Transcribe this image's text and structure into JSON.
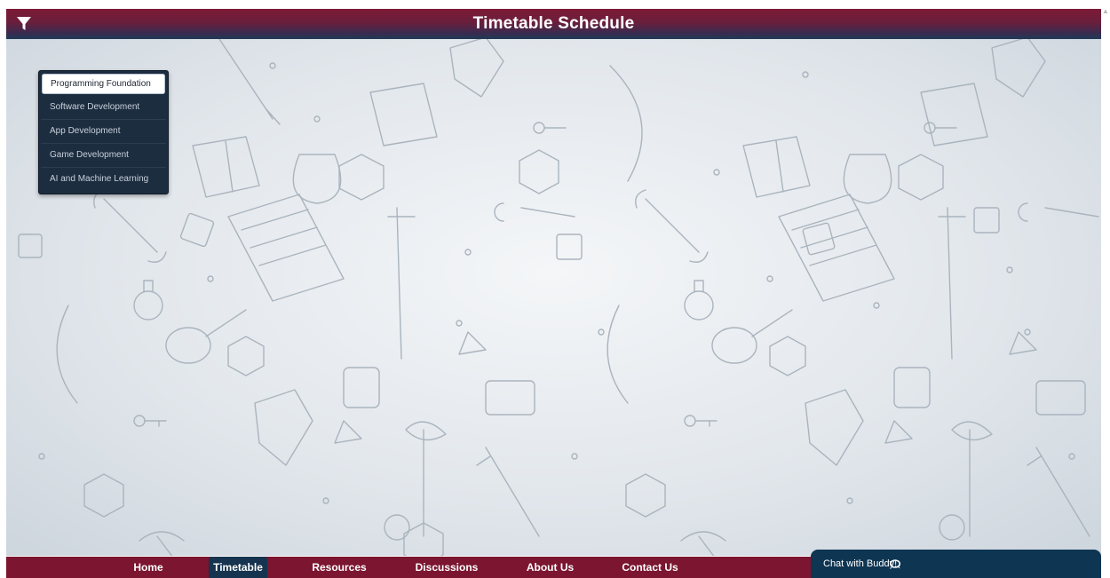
{
  "header": {
    "title": "Timetable Schedule",
    "filter_icon": "filter-funnel-icon",
    "gradient": [
      "#7c1a36",
      "#1f3a55"
    ]
  },
  "dropdown": {
    "items": [
      {
        "label": "Programming Foundation",
        "selected": true
      },
      {
        "label": "Software Development",
        "selected": false
      },
      {
        "label": "App Development",
        "selected": false
      },
      {
        "label": "Game Development",
        "selected": false
      },
      {
        "label": "AI and Machine Learning",
        "selected": false
      }
    ],
    "background": "#1d2d40"
  },
  "footer": {
    "background": "#7b1530",
    "nav": [
      {
        "label": "Home",
        "active": false
      },
      {
        "label": "Timetable",
        "active": true
      },
      {
        "label": "Resources",
        "active": false
      },
      {
        "label": "Discussions",
        "active": false
      },
      {
        "label": "About Us",
        "active": false
      },
      {
        "label": "Contact Us",
        "active": false
      }
    ],
    "active_color": "#16344f"
  },
  "chat": {
    "label": "Chat with Buddy!",
    "icon": "chat-bubble-icon",
    "background": "#0e3552"
  },
  "background": {
    "pattern": "tabletop-rpg-doodles"
  }
}
